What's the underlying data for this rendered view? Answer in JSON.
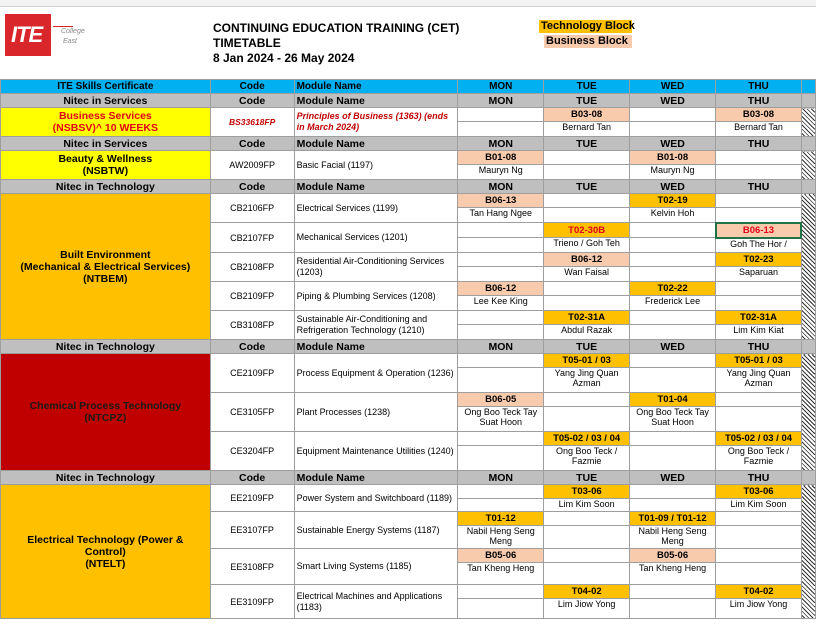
{
  "header": {
    "logo_text": "ITE",
    "logo_sub1": "College",
    "logo_sub2": "East",
    "title": "CONTINUING EDUCATION TRAINING (CET)",
    "subtitle": "TIMETABLE",
    "date_range": "8 Jan 2024 - 26 May 2024",
    "legend_technology": "Technology Block",
    "legend_business": "Business Block"
  },
  "columns": {
    "code": "Code",
    "module": "Module Name",
    "mon": "MON",
    "tue": "TUE",
    "wed": "WED",
    "thu": "THU"
  },
  "sections": {
    "skills_cert": "ITE Skills Certificate",
    "nitec_services": "Nitec in Services",
    "nitec_technology": "Nitec in Technology"
  },
  "programmes": {
    "business": {
      "name": "Business Services",
      "line2": "(NSBSV)^ 10 WEEKS"
    },
    "beauty": {
      "name": "Beauty & Wellness",
      "line2": "(NSBTW)"
    },
    "built": {
      "name": "Built Environment",
      "line2": "(Mechanical & Electrical Services)",
      "line3": "(NTBEM)"
    },
    "chemical": {
      "name": "Chemical Process Technology",
      "line2": "(NTCPZ)"
    },
    "electrical": {
      "name": "Electrical Technology (Power &",
      "line2": "Control)",
      "line3": "(NTELT)"
    }
  },
  "rows": {
    "bs33618": {
      "code": "BS33618FP",
      "module": "Principles of Business (1363) (ends in March 2024)",
      "tue_room": "B03-08",
      "tue_lect": "Bernard Tan",
      "thu_room": "B03-08",
      "thu_lect": "Bernard Tan"
    },
    "aw2009": {
      "code": "AW2009FP",
      "module": "Basic Facial (1197)",
      "mon_room": "B01-08",
      "mon_lect": "Mauryn Ng",
      "wed_room": "B01-08",
      "wed_lect": "Mauryn Ng"
    },
    "cb2106": {
      "code": "CB2106FP",
      "module": "Electrical Services (1199)",
      "mon_room": "B06-13",
      "mon_lect": "Tan Hang Ngee",
      "wed_room": "T02-19",
      "wed_lect": "Kelvin Hoh"
    },
    "cb2107": {
      "code": "CB2107FP",
      "module": "Mechanical Services (1201)",
      "tue_room": "T02-30B",
      "tue_lect": "Trieno / Goh Teh",
      "thu_room": "B06-13",
      "thu_lect": "Goh The Hor /"
    },
    "cb2108": {
      "code": "CB2108FP",
      "module": "Residential Air-Conditioning Services (1203)",
      "tue_room": "B06-12",
      "tue_lect": "Wan Faisal",
      "thu_room": "T02-23",
      "thu_lect": "Saparuan"
    },
    "cb2109": {
      "code": "CB2109FP",
      "module": "Piping & Plumbing Services (1208)",
      "mon_room": "B06-12",
      "mon_lect": "Lee Kee King",
      "wed_room": "T02-22",
      "wed_lect": "Frederick Lee"
    },
    "cb3108": {
      "code": "CB3108FP",
      "module": "Sustainable Air-Conditioning and Refrigeration Technology (1210)",
      "tue_room": "T02-31A",
      "tue_lect": "Abdul Razak",
      "thu_room": "T02-31A",
      "thu_lect": "Lim Kim Kiat"
    },
    "ce2109": {
      "code": "CE2109FP",
      "module": "Process Equipment & Operation (1236)",
      "tue_room": "T05-01 / 03",
      "tue_lect": "Yang Jing Quan Azman",
      "thu_room": "T05-01 / 03",
      "thu_lect": "Yang Jing Quan Azman"
    },
    "ce3105": {
      "code": "CE3105FP",
      "module": "Plant Processes (1238)",
      "mon_room": "B06-05",
      "mon_lect": "Ong Boo Teck Tay Suat Hoon",
      "wed_room": "T01-04",
      "wed_lect": "Ong Boo Teck Tay Suat Hoon"
    },
    "ce3204": {
      "code": "CE3204FP",
      "module": "Equipment Maintenance Utilities (1240)",
      "tue_room": "T05-02 / 03 / 04",
      "tue_lect": "Ong Boo Teck / Fazmie",
      "thu_room": "T05-02 / 03 / 04",
      "thu_lect": "Ong Boo Teck / Fazmie"
    },
    "ee2109": {
      "code": "EE2109FP",
      "module": "Power System and Switchboard (1189)",
      "tue_room": "T03-06",
      "tue_lect": "Lim Kim Soon",
      "thu_room": "T03-06",
      "thu_lect": "Lim Kim Soon"
    },
    "ee3107": {
      "code": "EE3107FP",
      "module": "Sustainable Energy Systems (1187)",
      "mon_room": "T01-12",
      "mon_lect": "Nabil Heng Seng Meng",
      "wed_room": "T01-09 / T01-12",
      "wed_lect": "Nabil Heng Seng Meng"
    },
    "ee3108": {
      "code": "EE3108FP",
      "module": "Smart Living Systems (1185)",
      "mon_room": "B05-06",
      "mon_lect": "Tan Kheng Heng",
      "wed_room": "B05-06",
      "wed_lect": "Tan Kheng Heng"
    },
    "ee3109": {
      "code": "EE3109FP",
      "module": "Electrical Machines and Applications (1183)",
      "tue_room": "T04-02",
      "tue_lect": "Lim Jiow Yong",
      "thu_room": "T04-02",
      "thu_lect": "Lim Jiow Yong"
    }
  },
  "colors": {
    "section_blue": "#00b0f0",
    "header_grey": "#bfbfbf",
    "business_yellow": "#ffff00",
    "technology_orange": "#ffc000",
    "chemical_red": "#c00000",
    "room_peach": "#f8cbad"
  }
}
